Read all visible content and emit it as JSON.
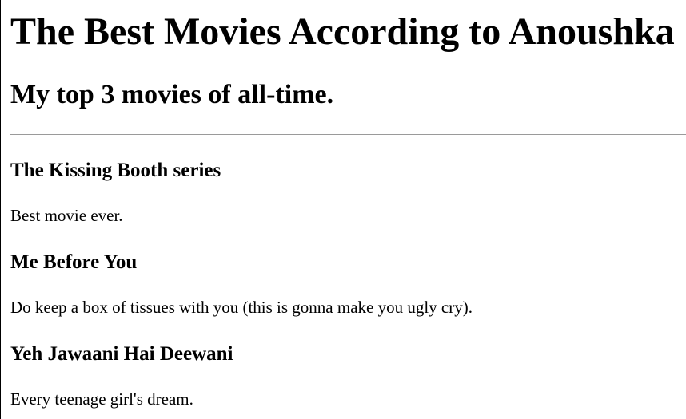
{
  "page": {
    "title": "The Best Movies According to Anoushka",
    "subtitle": "My top 3 movies of all-time."
  },
  "movies": [
    {
      "title": "The Kissing Booth series",
      "description": "Best movie ever."
    },
    {
      "title": "Me Before You",
      "description": "Do keep a box of tissues with you (this is gonna make you ugly cry)."
    },
    {
      "title": "Yeh Jawaani Hai Deewani",
      "description": "Every teenage girl's dream."
    }
  ]
}
